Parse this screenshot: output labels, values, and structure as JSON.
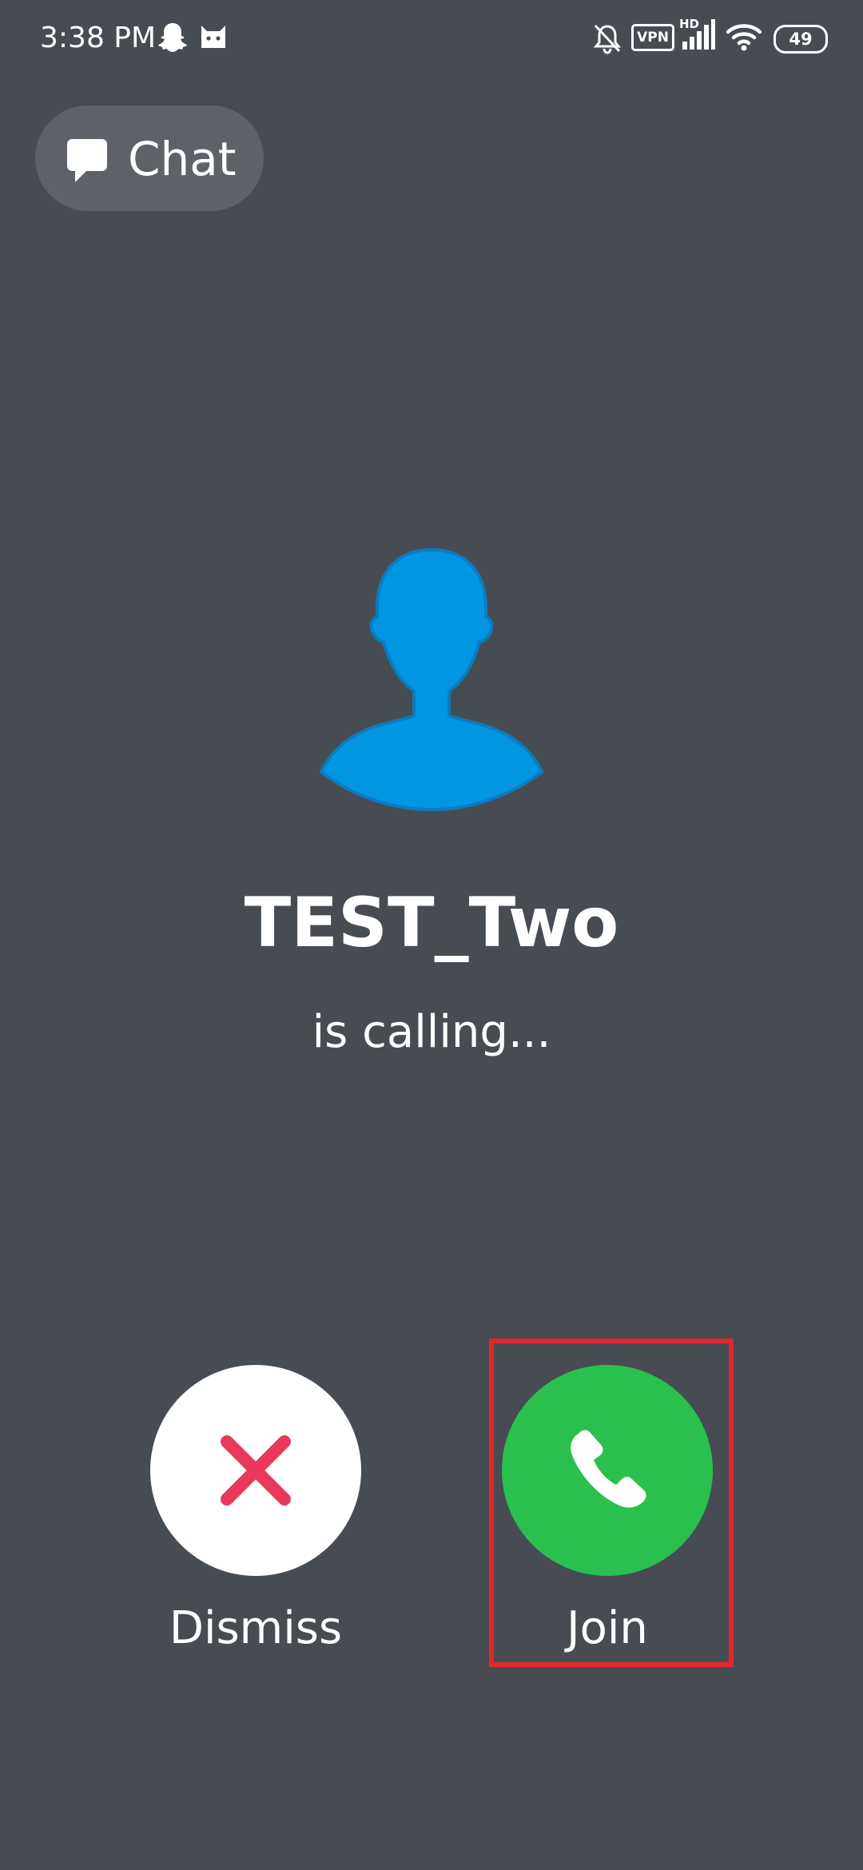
{
  "status_bar": {
    "time": "3:38 PM",
    "vpn_label": "VPN",
    "network_label": "HD",
    "battery_level": "49"
  },
  "chat_button": {
    "label": "Chat"
  },
  "caller": {
    "name": "TEST_Two",
    "status": "is calling..."
  },
  "actions": {
    "dismiss_label": "Dismiss",
    "join_label": "Join"
  },
  "colors": {
    "background": "#474c53",
    "avatar": "#0096e2",
    "join": "#2bbf4e",
    "dismiss_x": "#e8385b",
    "highlight": "#e3262d"
  }
}
